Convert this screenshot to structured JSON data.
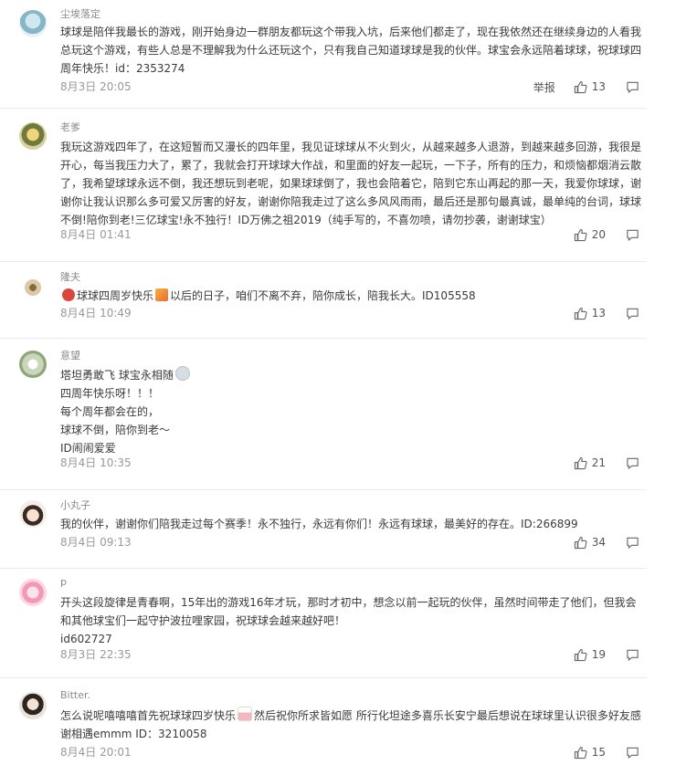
{
  "report_label": "举报",
  "comments": [
    {
      "username": "尘埃落定",
      "text": "球球是陪伴我最长的游戏，刚开始身边一群朋友都玩这个带我入坑，后来他们都走了，现在我依然还在继续身边的人看我总玩这个游戏，有些人总是不理解我为什么还玩这个，只有我自己知道球球是我的伙伴。球宝会永远陪着球球，祝球球四周年快乐！id：2353274",
      "timestamp": "8月3日 20:05",
      "likes": "13"
    },
    {
      "username": "老爹",
      "text": "我玩这游戏四年了，在这短暂而又漫长的四年里，我见证球球从不火到火，从越来越多人退游，到越来越多回游，我很是开心，每当我压力大了，累了，我就会打开球球大作战，和里面的好友一起玩，一下子，所有的压力，和烦恼都烟消云散了，我希望球球永远不倒，我还想玩到老呢，如果球球倒了，我也会陪着它，陪到它东山再起的那一天，我爱你球球，谢谢你让我认识那么多可爱又厉害的好友，谢谢你陪我走过了这么多风风雨雨，最后还是那句最真诚，最单纯的台词，球球不倒!陪你到老!三亿球宝!永不独行！ID万佛之祖2019（纯手写的，不喜勿喷，请勿抄袭，谢谢球宝）",
      "timestamp": "8月4日 01:41",
      "likes": "20"
    },
    {
      "username": "隆夫",
      "text_before": "",
      "text_after": "球球四周岁快乐",
      "text_end": "以后的日子，咱们不离不弃，陪你成长，陪我长大。ID105558",
      "timestamp": "8月4日 10:49",
      "likes": "13"
    },
    {
      "username": "意望",
      "line1": "塔坦勇敢飞 球宝永相随",
      "line2": "四周年快乐呀！！！",
      "line3": "每个周年都会在的，",
      "line4": "球球不倒，陪你到老～",
      "line5": "ID闹闹爱爱",
      "timestamp": "8月4日 10:35",
      "likes": "21"
    },
    {
      "username": "小丸子",
      "text": "我的伙伴，谢谢你们陪我走过每个赛季！永不独行，永远有你们！永远有球球，最美好的存在。ID:266899",
      "timestamp": "8月4日 09:13",
      "likes": "34"
    },
    {
      "username": "р",
      "text": "开头这段旋律是青春啊，15年出的游戏16年才玩，那时才初中，想念以前一起玩的伙伴，虽然时间带走了他们，但我会和其他球宝们一起守护波拉哩家园，祝球球会越来越好吧！",
      "text2": "id602727",
      "timestamp": "8月3日 22:35",
      "likes": "19"
    },
    {
      "username": "Bitter.",
      "text_a": "怎么说呢嘻嘻嘻首先祝球球四岁快乐",
      "text_b": "然后祝你所求皆如愿 所行化坦途多喜乐长安宁最后想说在球球里认识很多好友感谢相遇emmm ID：3210058",
      "timestamp": "8月4日 20:01",
      "likes": "15"
    }
  ],
  "colors": {
    "text": "#3a3a3a",
    "meta": "#999999",
    "username": "#8a8a8a",
    "divider": "#ececec"
  }
}
